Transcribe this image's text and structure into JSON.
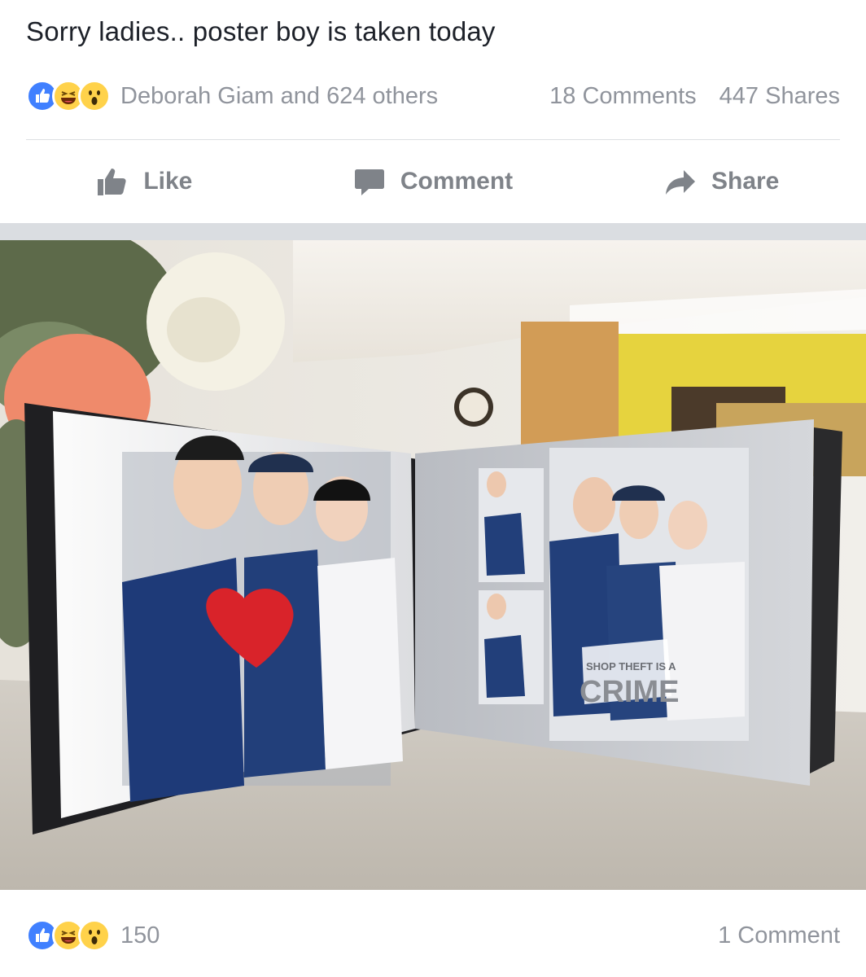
{
  "post": {
    "text": "Sorry ladies.. poster boy is taken today"
  },
  "stats": {
    "reaction_icons": [
      "like-icon",
      "haha-icon",
      "wow-icon"
    ],
    "reactors": "Deborah Giam and 624 others",
    "comments": "18 Comments",
    "shares": "447 Shares"
  },
  "actions": {
    "like": "Like",
    "comment": "Comment",
    "share": "Share"
  },
  "photo": {
    "sign_top": "SHOP THEFT IS A",
    "sign_bottom": "CRIME"
  },
  "footer": {
    "reaction_icons": [
      "like-icon",
      "haha-icon",
      "wow-icon"
    ],
    "count": "150",
    "comments": "1 Comment"
  },
  "colors": {
    "like_blue": "#4080ff",
    "emoji_yellow": "#ffd24a",
    "meta_grey": "#90949c",
    "action_grey": "#7f8389"
  }
}
